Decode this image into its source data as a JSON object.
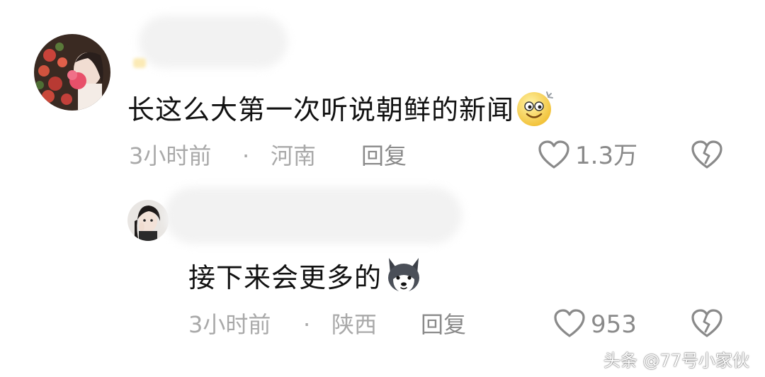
{
  "comments": [
    {
      "text": "长这么大第一次听说朝鲜的新闻",
      "emoji": "smiling-face-emoji",
      "time": "3小时前",
      "location": "河南",
      "reply_label": "回复",
      "likes": "1.3万"
    },
    {
      "text": "接下来会更多的",
      "emoji": "husky-dog-emoji",
      "time": "3小时前",
      "location": "陕西",
      "reply_label": "回复",
      "likes": "953"
    }
  ],
  "separator": "·",
  "watermark": "头条 @77号小家伙",
  "icons": {
    "like": "heart-outline-icon",
    "dislike": "broken-heart-icon"
  },
  "colors": {
    "meta_text": "#a9a9a9",
    "action_text": "#8a8a8a",
    "main_text": "#111111"
  }
}
